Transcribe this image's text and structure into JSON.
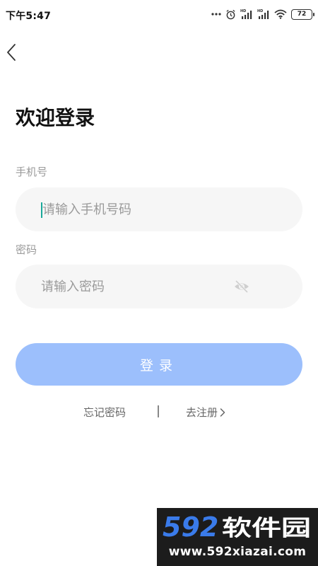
{
  "status_bar": {
    "time": "下午5:47",
    "battery_level": "72",
    "icons": [
      "more-dots-icon",
      "alarm-icon",
      "hd-signal-icon",
      "hd-signal-icon",
      "wifi-icon",
      "battery-icon"
    ]
  },
  "header": {
    "back_icon": "chevron-left-icon"
  },
  "page": {
    "title": "欢迎登录"
  },
  "form": {
    "phone_label": "手机号",
    "phone_placeholder": "请输入手机号码",
    "phone_value": "",
    "password_label": "密码",
    "password_placeholder": "请输入密码",
    "password_value": "",
    "password_toggle_icon": "eye-icon",
    "login_label": "登录"
  },
  "links": {
    "forgot_password": "忘记密码",
    "register": "去注册",
    "register_icon": "chevron-right-icon"
  },
  "watermark": {
    "logo_text": "592软件园",
    "url": "www.592xiazai.com"
  },
  "colors": {
    "accent": "#9cbffc",
    "input_bg": "#f6f6f6",
    "caret": "#1aa89a",
    "watermark_bg": "#1c1c1c",
    "watermark_blue": "#3a7bea"
  }
}
